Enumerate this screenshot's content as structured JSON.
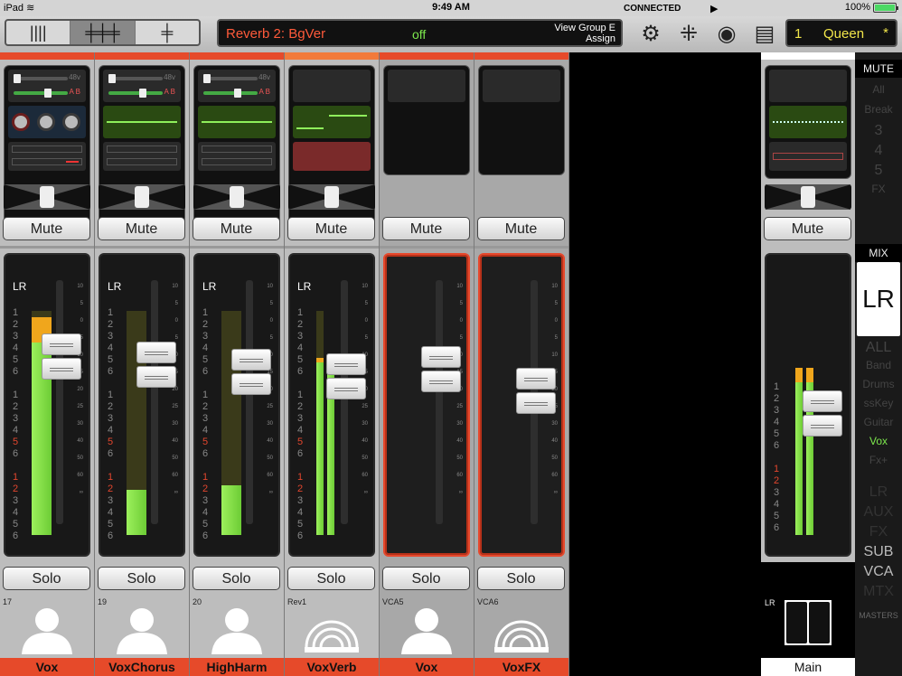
{
  "status": {
    "device": "iPad",
    "time": "9:49 AM",
    "battery": "100%"
  },
  "toolbar": {
    "fx_name": "Reverb 2: BgVer",
    "fx_state": "off",
    "view_group": "View Group E",
    "assign": "Assign",
    "connected": "CONNECTED",
    "scene_number": "1",
    "scene_name": "Queen",
    "scene_mark": "*"
  },
  "icons": [
    "gear-icon",
    "routing-icon",
    "record-icon",
    "layout-icon"
  ],
  "strips": [
    {
      "num": "17",
      "name": "Vox",
      "type": "channel",
      "fader": 0.78,
      "meter": 0.86,
      "meter_peak": 0.05
    },
    {
      "num": "19",
      "name": "VoxChorus",
      "type": "channel",
      "fader": 0.75,
      "meter": 0.2,
      "meter_peak": 0
    },
    {
      "num": "20",
      "name": "HighHarm",
      "type": "channel",
      "fader": 0.72,
      "meter": 0.22,
      "meter_peak": 0
    },
    {
      "num": "Rev1",
      "name": "VoxVerb",
      "type": "fx",
      "fader": 0.7,
      "meter": 0.77,
      "meter_peak": 0
    },
    {
      "num": "VCA5",
      "name": "Vox",
      "type": "vca",
      "fader": 0.73,
      "meter": 0,
      "meter_peak": 0
    },
    {
      "num": "VCA6",
      "name": "VoxFX",
      "type": "vcafx",
      "fader": 0.64,
      "meter": 0,
      "meter_peak": 0
    }
  ],
  "labels": {
    "mute": "Mute",
    "solo": "Solo",
    "lr": "LR",
    "main": "Main",
    "ab": "A B",
    "v48": "48v"
  },
  "scale": [
    "10",
    "5",
    "0",
    "5",
    "10",
    "15",
    "20",
    "25",
    "30",
    "40",
    "50",
    "60",
    "∞"
  ],
  "main": {
    "fader": 0.55,
    "meter": 0.68
  },
  "right_panel": {
    "mute_header": "MUTE",
    "mute_items": [
      "All",
      "Break",
      "3",
      "4",
      "5",
      "FX"
    ],
    "mix_header": "MIX",
    "selected_mix": "LR",
    "mix_items": [
      "ALL",
      "Band",
      "Drums",
      "ssKey",
      "Guitar",
      "Vox",
      "Fx+"
    ],
    "active_mix": "Vox",
    "lower_items": [
      "LR",
      "AUX",
      "FX",
      "SUB",
      "VCA",
      "MTX"
    ],
    "masters": "MASTERS"
  },
  "colors": {
    "accent": "#e64a2a",
    "green": "#7de84d",
    "scene": "#f2e64a"
  }
}
